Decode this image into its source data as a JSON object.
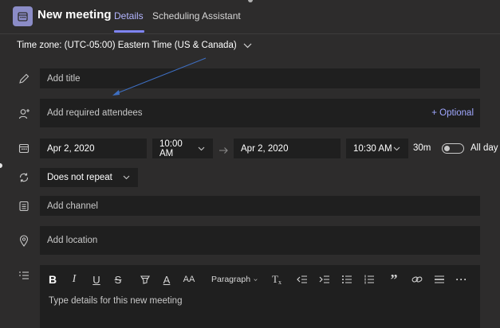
{
  "header": {
    "title": "New meeting",
    "tabs": [
      {
        "label": "Details",
        "active": true
      },
      {
        "label": "Scheduling Assistant",
        "active": false
      }
    ]
  },
  "timezone": {
    "label": "Time zone: (UTC-05:00) Eastern Time (US & Canada)"
  },
  "form": {
    "title_placeholder": "Add title",
    "attendees_placeholder": "Add required attendees",
    "optional_label": "+ Optional",
    "start_date": "Apr 2, 2020",
    "start_time": "10:00 AM",
    "end_date": "Apr 2, 2020",
    "end_time": "10:30 AM",
    "duration": "30m",
    "all_day_label": "All day",
    "repeat": "Does not repeat",
    "channel_placeholder": "Add channel",
    "location_placeholder": "Add location"
  },
  "editor": {
    "paragraph_label": "Paragraph",
    "placeholder": "Type details for this new meeting"
  },
  "colors": {
    "background": "#2d2c2c",
    "field": "#1f1f1f",
    "accent": "#7f85f5",
    "annotation_arrow": "#3e6fc2"
  }
}
